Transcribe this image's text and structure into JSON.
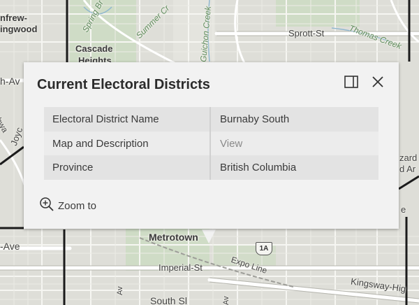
{
  "map": {
    "labels": {
      "renfrew": "nfrew-",
      "collingwood": "ingwood",
      "cascade": "Cascade",
      "heights": "Heights",
      "sprott": "Sprott-St",
      "thomas_creek": "Thomas Creek",
      "spring_brook": "Spring Br",
      "summer_creek": "Summer Cr",
      "guichon_creek": "Guichon Creek",
      "hwy_partial": "ghwa",
      "joyce": "Joyc",
      "ave_left": "h-Av",
      "ave_left2": "-Ave",
      "metrotown": "Metrotown",
      "imperial": "Imperial-St",
      "expo": "Expo Line",
      "kingsway": "Kingsway-Hig",
      "south_partial": "South Sl",
      "av_bottom": "Av",
      "ave_bottom2": "Av",
      "right_partial1": "zard",
      "right_partial2": "d Ar",
      "right_partial3": "e"
    },
    "shield": "1A"
  },
  "popup": {
    "title": "Current Electoral Districts",
    "dock_icon": "dock-panel-icon",
    "close_icon": "close-icon",
    "rows": [
      {
        "key": "Electoral District Name",
        "value": "Burnaby South"
      },
      {
        "key": "Map and Description",
        "value": "View"
      },
      {
        "key": "Province",
        "value": "British Columbia"
      }
    ],
    "zoom_icon": "zoom-in-icon",
    "zoom_label": "Zoom to"
  }
}
